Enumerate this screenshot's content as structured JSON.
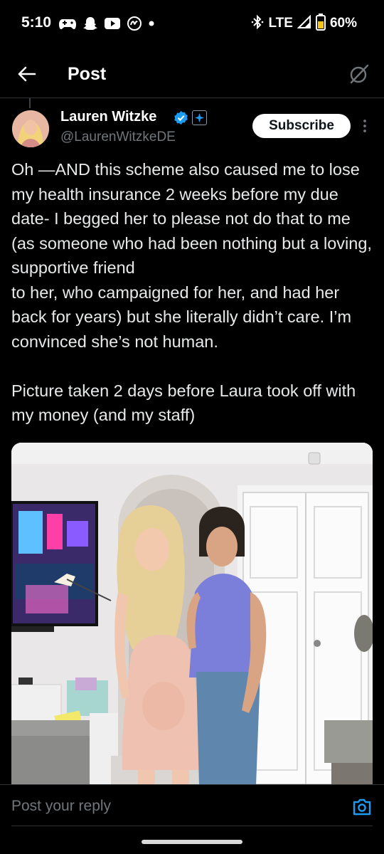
{
  "status_bar": {
    "time": "5:10",
    "network": "LTE",
    "battery_percent": "60%",
    "notification_icons": [
      "gamepad-icon",
      "snapchat-icon",
      "youtube-icon",
      "threads-icon",
      "dot-icon"
    ],
    "status_icons": [
      "bluetooth-icon",
      "signal-icon",
      "battery-icon"
    ]
  },
  "nav": {
    "title": "Post",
    "back_icon": "back-arrow-icon",
    "grok_icon": "grok-icon"
  },
  "tweet": {
    "author_name": "Lauren Witzke",
    "author_handle": "@LaurenWitzkeDE",
    "subscribe_label": "Subscribe",
    "text": "Oh —AND this scheme also caused me to lose my health insurance 2 weeks before my due date- I begged her to please not do that to me (as someone who had been nothing but a loving, supportive friend\nto her, who campaigned for her, and had her back for years) but she literally didn’t care. I’m convinced she’s not human.\n\nPicture taken 2 days before Laura took off with my money (and my staff)"
  },
  "reply": {
    "placeholder": "Post your reply",
    "camera_icon": "camera-icon"
  },
  "colors": {
    "background": "#000000",
    "text": "#e7e9ea",
    "secondary": "#71767b",
    "verified": "#1d9bf0",
    "divider": "#2f3336"
  }
}
